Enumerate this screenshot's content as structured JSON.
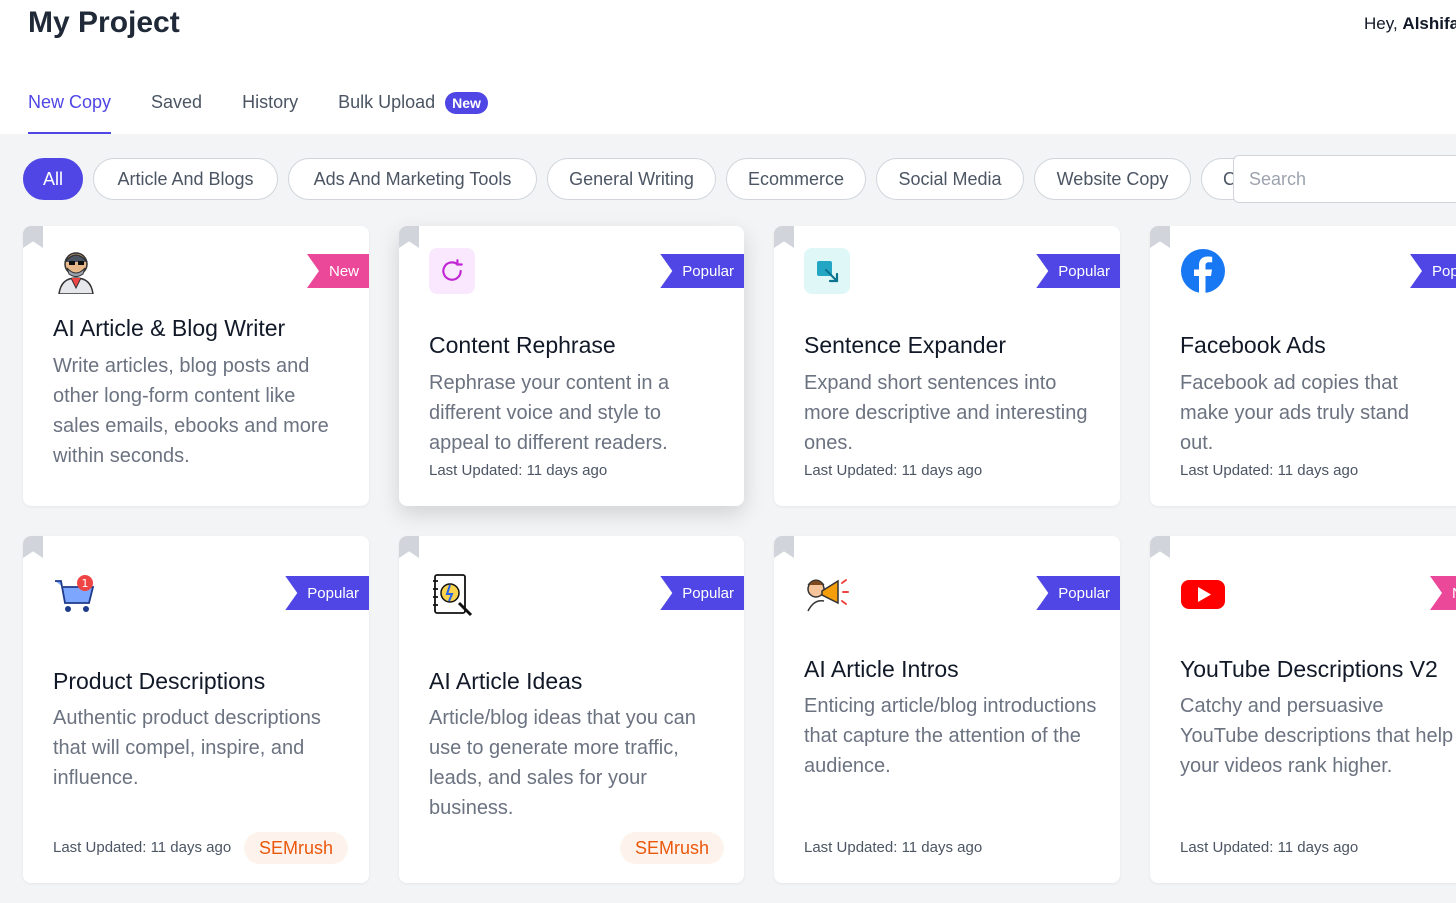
{
  "header": {
    "title": "My Project",
    "greeting_prefix": "Hey, ",
    "user_name": "Alshifa"
  },
  "tabs": [
    {
      "label": "New Copy",
      "active": true
    },
    {
      "label": "Saved"
    },
    {
      "label": "History"
    },
    {
      "label": "Bulk Upload",
      "badge": "New"
    }
  ],
  "filters": [
    "All",
    "Article And Blogs",
    "Ads And Marketing Tools",
    "General Writing",
    "Ecommerce",
    "Social Media",
    "Website Copy",
    "Copywriting"
  ],
  "search": {
    "placeholder": "Search"
  },
  "colors": {
    "accent": "#4f46e5",
    "new_badge": "#ec4899",
    "semrush": "#ea580c"
  },
  "cards": [
    {
      "title": "AI Article & Blog Writer",
      "description": "Write articles, blog posts and other long-form content like sales emails, ebooks and more within seconds.",
      "badge": "New",
      "icon": "robot-writer-icon"
    },
    {
      "title": "Content Rephrase",
      "description": "Rephrase your content in a different voice and style to appeal to different readers.",
      "updated": "Last Updated: 11 days ago",
      "badge": "Popular",
      "icon": "refresh-icon"
    },
    {
      "title": "Sentence Expander",
      "description": "Expand short sentences into more descriptive and interesting ones.",
      "updated": "Last Updated: 11 days ago",
      "badge": "Popular",
      "icon": "expand-arrow-icon"
    },
    {
      "title": "Facebook Ads",
      "description": "Facebook ad copies that make your ads truly stand out.",
      "updated": "Last Updated: 11 days ago",
      "badge": "Popular",
      "icon": "facebook-icon"
    },
    {
      "title": "Product Descriptions",
      "description": "Authentic product descriptions that will compel, inspire, and influence.",
      "updated": "Last Updated: 11 days ago",
      "badge": "Popular",
      "tag": "SEMrush",
      "icon": "shopping-cart-icon"
    },
    {
      "title": "AI Article Ideas",
      "description": "Article/blog ideas that you can use to generate more traffic, leads, and sales for your business.",
      "badge": "Popular",
      "tag": "SEMrush",
      "icon": "idea-notebook-icon"
    },
    {
      "title": "AI Article Intros",
      "description": "Enticing article/blog introductions that capture the attention of the audience.",
      "updated": "Last Updated: 11 days ago",
      "badge": "Popular",
      "icon": "megaphone-icon"
    },
    {
      "title": "YouTube Descriptions V2",
      "description": "Catchy and persuasive YouTube descriptions that help your videos rank higher.",
      "updated": "Last Updated: 11 days ago",
      "badge": "New",
      "icon": "youtube-icon"
    }
  ]
}
